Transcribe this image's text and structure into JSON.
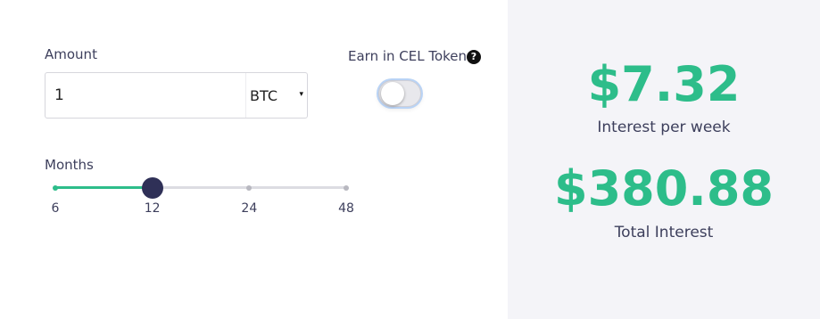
{
  "amount": {
    "label": "Amount",
    "value": "1",
    "currency": "BTC",
    "currency_caret": "▾"
  },
  "earn": {
    "label": "Earn in CEL Token",
    "help_icon": "?",
    "toggle_on": false
  },
  "months": {
    "label": "Months",
    "ticks": [
      "6",
      "12",
      "24",
      "48"
    ],
    "selected": "12"
  },
  "results": {
    "weekly_value": "$7.32",
    "weekly_caption": "Interest per week",
    "total_value": "$380.88",
    "total_caption": "Total Interest"
  },
  "colors": {
    "accent": "#2dbd8a",
    "thumb": "#2f3057",
    "panel": "#f4f4f8",
    "text": "#3d3f5c"
  }
}
